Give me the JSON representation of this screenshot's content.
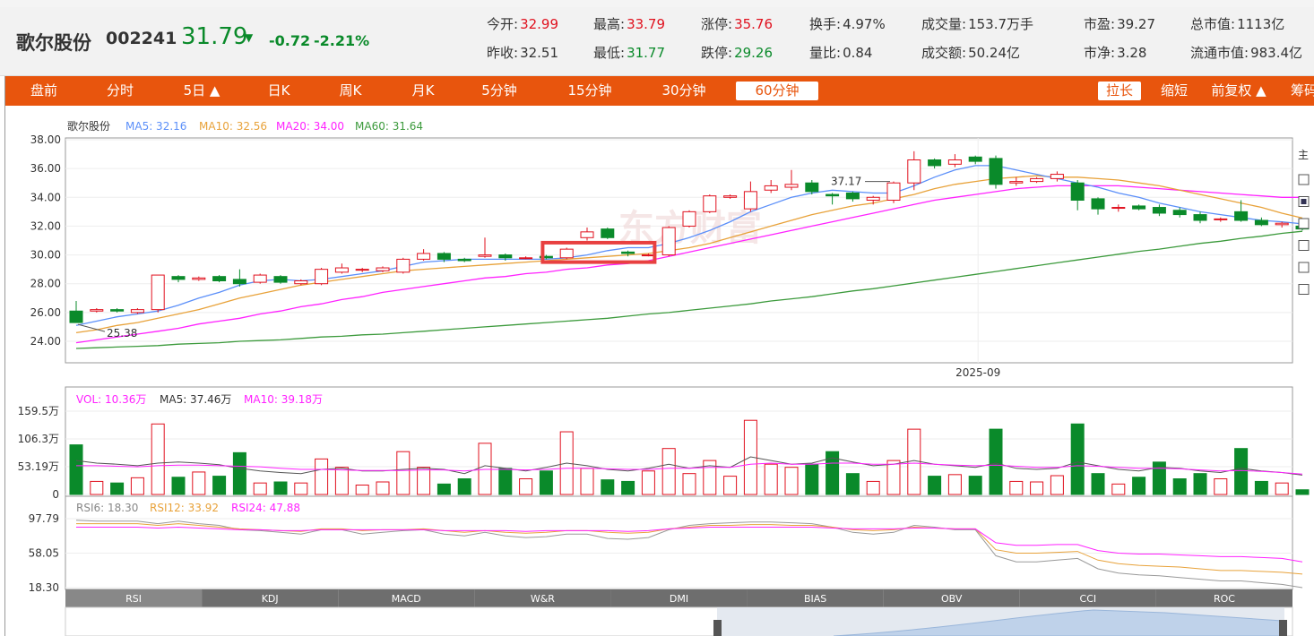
{
  "header": {
    "name": "歌尔股份",
    "code": "002241",
    "price": "31.79",
    "arrow": "▼",
    "change": "-0.72",
    "change_pct": "-2.21%",
    "quotes": [
      {
        "label": "今开:",
        "value": "32.99",
        "color": "red"
      },
      {
        "label": "最高:",
        "value": "33.79",
        "color": "red"
      },
      {
        "label": "涨停:",
        "value": "35.76",
        "color": "red"
      },
      {
        "label": "换手:",
        "value": "4.97%",
        "color": "dark"
      },
      {
        "label": "成交量:",
        "value": "153.7万手",
        "color": "dark"
      },
      {
        "label": "市盈:",
        "value": "39.27",
        "color": "dark"
      },
      {
        "label": "总市值:",
        "value": "1113亿",
        "color": "dark"
      },
      {
        "label": "昨收:",
        "value": "32.51",
        "color": "dark"
      },
      {
        "label": "最低:",
        "value": "31.77",
        "color": "green"
      },
      {
        "label": "跌停:",
        "value": "29.26",
        "color": "green"
      },
      {
        "label": "量比:",
        "value": "0.84",
        "color": "dark"
      },
      {
        "label": "成交额:",
        "value": "50.24亿",
        "color": "dark"
      },
      {
        "label": "市净:",
        "value": "3.28",
        "color": "dark"
      },
      {
        "label": "流通市值:",
        "value": "983.4亿",
        "color": "dark"
      }
    ]
  },
  "tabs": [
    "盘前",
    "分时",
    "5日 ▲",
    "日K",
    "周K",
    "月K",
    "5分钟",
    "15分钟",
    "30分钟",
    "60分钟"
  ],
  "active_tab": 9,
  "right_tabs": [
    "拉长",
    "缩短",
    "前复权 ▲",
    "筹码"
  ],
  "active_right_tab": 0,
  "watermark": "东方财富",
  "indicator_tabs": [
    "RSI",
    "KDJ",
    "MACD",
    "W&R",
    "DMI",
    "BIAS",
    "OBV",
    "CCI",
    "ROC"
  ],
  "active_indicator": 0,
  "side_label": "主",
  "colors": {
    "up": "#e0111e",
    "down": "#0a8a2a",
    "accent": "#e8550d",
    "ma5": "#5b8ff9",
    "ma10": "#e8a23a",
    "ma20": "#ff22ff",
    "ma60": "#3c9a3c"
  },
  "chart_data": {
    "type": "candlestick",
    "name": "歌尔股份",
    "interval": "60分钟",
    "x_label_tick": "2025-09",
    "ylim": [
      24,
      38
    ],
    "yticks": [
      "38.00",
      "36.00",
      "34.00",
      "32.00",
      "30.00",
      "28.00",
      "26.00",
      "24.00"
    ],
    "grid": true,
    "legend": [
      {
        "name": "MA5",
        "value": "32.16"
      },
      {
        "name": "MA10",
        "value": "32.56"
      },
      {
        "name": "MA20",
        "value": "34.00"
      },
      {
        "name": "MA60",
        "value": "31.64"
      }
    ],
    "annotations": [
      {
        "text": "37.17",
        "candle": 40
      },
      {
        "text": "25.38",
        "candle": 0
      }
    ],
    "candles": [
      [
        26.1,
        25.3,
        26.8,
        25.3
      ],
      [
        26.1,
        26.2,
        26.3,
        26.0
      ],
      [
        26.2,
        26.1,
        26.3,
        26.0
      ],
      [
        26.0,
        26.2,
        26.3,
        25.9
      ],
      [
        26.2,
        28.6,
        28.6,
        26.0
      ],
      [
        28.5,
        28.3,
        28.6,
        28.1
      ],
      [
        28.3,
        28.4,
        28.5,
        28.2
      ],
      [
        28.5,
        28.2,
        28.6,
        28.1
      ],
      [
        28.3,
        28.0,
        29.0,
        27.8
      ],
      [
        28.1,
        28.6,
        28.7,
        28.0
      ],
      [
        28.5,
        28.1,
        28.6,
        28.0
      ],
      [
        28.0,
        28.2,
        28.3,
        27.9
      ],
      [
        28.0,
        29.0,
        29.1,
        27.9
      ],
      [
        28.8,
        29.1,
        29.4,
        28.7
      ],
      [
        29.0,
        29.0,
        29.1,
        28.8
      ],
      [
        28.9,
        29.1,
        29.2,
        28.8
      ],
      [
        28.8,
        29.7,
        29.8,
        28.7
      ],
      [
        29.7,
        30.1,
        30.4,
        29.6
      ],
      [
        30.1,
        29.7,
        30.2,
        29.5
      ],
      [
        29.7,
        29.6,
        29.8,
        29.5
      ],
      [
        29.9,
        30.0,
        31.2,
        29.8
      ],
      [
        30.0,
        29.8,
        30.1,
        29.6
      ],
      [
        29.8,
        29.8,
        29.9,
        29.7
      ],
      [
        29.9,
        29.8,
        30.0,
        29.7
      ],
      [
        29.8,
        30.4,
        30.5,
        29.7
      ],
      [
        31.2,
        31.6,
        31.9,
        31.0
      ],
      [
        31.8,
        31.2,
        31.9,
        31.1
      ],
      [
        30.2,
        30.1,
        30.3,
        29.9
      ],
      [
        30.0,
        30.0,
        30.1,
        29.9
      ],
      [
        30.0,
        31.9,
        32.0,
        29.9
      ],
      [
        32.0,
        33.0,
        33.1,
        31.9
      ],
      [
        33.0,
        34.1,
        34.2,
        32.9
      ],
      [
        34.0,
        34.1,
        34.2,
        33.9
      ],
      [
        33.2,
        34.4,
        35.1,
        33.0
      ],
      [
        34.5,
        34.8,
        35.2,
        34.3
      ],
      [
        34.7,
        34.9,
        35.9,
        34.5
      ],
      [
        35.0,
        34.4,
        35.2,
        34.2
      ],
      [
        34.2,
        34.1,
        34.3,
        33.5
      ],
      [
        34.3,
        33.9,
        34.4,
        33.7
      ],
      [
        33.8,
        34.0,
        34.1,
        33.5
      ],
      [
        33.8,
        35.0,
        35.1,
        33.6
      ],
      [
        35.0,
        36.6,
        37.2,
        34.5
      ],
      [
        36.6,
        36.2,
        36.7,
        36.0
      ],
      [
        36.3,
        36.6,
        37.0,
        36.1
      ],
      [
        36.8,
        36.5,
        36.9,
        36.3
      ],
      [
        36.7,
        34.9,
        36.9,
        34.6
      ],
      [
        35.0,
        35.1,
        35.4,
        34.8
      ],
      [
        35.1,
        35.3,
        35.4,
        35.0
      ],
      [
        35.3,
        35.6,
        35.8,
        35.1
      ],
      [
        35.0,
        33.8,
        35.2,
        33.1
      ],
      [
        33.9,
        33.2,
        34.0,
        32.8
      ],
      [
        33.3,
        33.3,
        33.5,
        33.0
      ],
      [
        33.4,
        33.2,
        33.5,
        33.1
      ],
      [
        33.3,
        32.9,
        33.5,
        32.7
      ],
      [
        33.1,
        32.8,
        33.3,
        32.6
      ],
      [
        32.8,
        32.4,
        33.0,
        32.2
      ],
      [
        32.5,
        32.5,
        32.6,
        32.3
      ],
      [
        33.0,
        32.4,
        33.8,
        32.3
      ],
      [
        32.4,
        32.1,
        32.6,
        32.0
      ],
      [
        32.1,
        32.2,
        32.3,
        31.9
      ],
      [
        32.0,
        31.8,
        32.1,
        31.7
      ]
    ],
    "ma5": [
      25.1,
      25.4,
      25.7,
      25.9,
      26.1,
      26.5,
      27.0,
      27.4,
      27.9,
      28.2,
      28.3,
      28.2,
      28.3,
      28.5,
      28.7,
      28.9,
      29.2,
      29.5,
      29.6,
      29.7,
      29.7,
      29.7,
      29.7,
      29.7,
      29.8,
      30.0,
      30.3,
      30.5,
      30.5,
      30.8,
      31.2,
      31.7,
      32.3,
      33.0,
      33.5,
      34.0,
      34.3,
      34.5,
      34.4,
      34.3,
      34.3,
      34.8,
      35.4,
      35.9,
      36.2,
      36.2,
      35.9,
      35.6,
      35.3,
      35.0,
      34.7,
      34.3,
      34.0,
      33.6,
      33.3,
      33.0,
      32.8,
      32.6,
      32.4,
      32.3,
      32.16
    ],
    "ma10": [
      24.6,
      24.8,
      25.1,
      25.3,
      25.6,
      25.9,
      26.2,
      26.6,
      27.0,
      27.3,
      27.6,
      27.9,
      28.1,
      28.3,
      28.5,
      28.7,
      28.9,
      29.0,
      29.1,
      29.2,
      29.3,
      29.4,
      29.5,
      29.6,
      29.7,
      29.8,
      29.9,
      30.0,
      30.1,
      30.3,
      30.5,
      30.8,
      31.2,
      31.6,
      32.0,
      32.4,
      32.8,
      33.1,
      33.4,
      33.6,
      33.9,
      34.2,
      34.6,
      34.9,
      35.1,
      35.3,
      35.4,
      35.5,
      35.4,
      35.4,
      35.3,
      35.2,
      35.0,
      34.8,
      34.5,
      34.2,
      33.9,
      33.6,
      33.3,
      32.9,
      32.56
    ],
    "ma20": [
      23.9,
      24.1,
      24.3,
      24.5,
      24.7,
      24.9,
      25.2,
      25.4,
      25.6,
      25.9,
      26.1,
      26.4,
      26.6,
      26.9,
      27.1,
      27.4,
      27.6,
      27.8,
      28.0,
      28.2,
      28.4,
      28.5,
      28.7,
      28.8,
      29.0,
      29.1,
      29.3,
      29.4,
      29.6,
      29.9,
      30.2,
      30.5,
      30.8,
      31.1,
      31.4,
      31.7,
      32.0,
      32.3,
      32.6,
      32.9,
      33.2,
      33.5,
      33.8,
      34.0,
      34.2,
      34.4,
      34.6,
      34.7,
      34.8,
      34.8,
      34.8,
      34.8,
      34.7,
      34.6,
      34.5,
      34.4,
      34.3,
      34.2,
      34.1,
      34.0,
      34.0
    ],
    "ma60": [
      23.5,
      23.55,
      23.6,
      23.65,
      23.7,
      23.8,
      23.85,
      23.9,
      24.0,
      24.05,
      24.1,
      24.2,
      24.3,
      24.35,
      24.45,
      24.5,
      24.6,
      24.7,
      24.8,
      24.9,
      25.0,
      25.1,
      25.2,
      25.3,
      25.4,
      25.5,
      25.6,
      25.75,
      25.9,
      26.0,
      26.15,
      26.3,
      26.45,
      26.6,
      26.8,
      26.95,
      27.1,
      27.3,
      27.5,
      27.65,
      27.85,
      28.05,
      28.25,
      28.45,
      28.65,
      28.85,
      29.05,
      29.25,
      29.45,
      29.65,
      29.85,
      30.05,
      30.25,
      30.4,
      30.6,
      30.8,
      30.95,
      31.15,
      31.3,
      31.5,
      31.64
    ],
    "volume": {
      "label": "VOL",
      "value": "10.36万",
      "ma5": "37.46万",
      "ma10": "39.18万",
      "ylim": [
        0,
        159.5
      ],
      "yticks": [
        "159.5万",
        "106.3万",
        "53.19万",
        "0"
      ],
      "values": [
        95,
        25,
        22,
        32,
        135,
        33,
        43,
        35,
        80,
        22,
        24,
        22,
        68,
        52,
        18,
        24,
        82,
        52,
        20,
        30,
        98,
        50,
        30,
        45,
        120,
        50,
        28,
        25,
        45,
        88,
        40,
        65,
        35,
        142,
        58,
        52,
        58,
        82,
        40,
        25,
        65,
        125,
        35,
        38,
        35,
        125,
        25,
        24,
        36,
        135,
        40,
        20,
        33,
        62,
        30,
        40,
        30,
        88,
        25,
        22,
        9
      ],
      "ma5_values": [
        65,
        60,
        58,
        55,
        60,
        62,
        60,
        57,
        50,
        45,
        42,
        40,
        48,
        50,
        45,
        45,
        48,
        50,
        48,
        40,
        55,
        50,
        45,
        52,
        60,
        55,
        48,
        45,
        50,
        58,
        50,
        55,
        52,
        72,
        65,
        58,
        60,
        70,
        62,
        55,
        58,
        65,
        58,
        55,
        52,
        60,
        50,
        48,
        50,
        62,
        55,
        48,
        45,
        52,
        50,
        45,
        42,
        50,
        45,
        42,
        37
      ],
      "ma10_values": [
        55,
        55,
        54,
        53,
        55,
        56,
        56,
        55,
        54,
        53,
        50,
        48,
        48,
        47,
        46,
        46,
        46,
        47,
        47,
        45,
        48,
        48,
        47,
        48,
        50,
        50,
        49,
        48,
        48,
        50,
        50,
        52,
        52,
        58,
        60,
        58,
        58,
        60,
        60,
        58,
        58,
        60,
        58,
        56,
        55,
        56,
        54,
        52,
        52,
        55,
        54,
        52,
        50,
        50,
        49,
        47,
        45,
        46,
        44,
        42,
        39
      ]
    },
    "rsi": {
      "label": "RSI",
      "rsi6": "18.30",
      "rsi12": "33.92",
      "rsi24": "47.88",
      "ylim": [
        18.3,
        97.79
      ],
      "yticks": [
        "97.79",
        "58.05",
        "18.30"
      ],
      "rsi6_values": [
        96,
        95,
        95,
        95,
        92,
        95,
        92,
        90,
        85,
        84,
        82,
        80,
        85,
        85,
        80,
        82,
        84,
        85,
        80,
        78,
        82,
        78,
        76,
        77,
        80,
        80,
        75,
        74,
        76,
        85,
        90,
        92,
        93,
        94,
        94,
        93,
        92,
        88,
        82,
        80,
        82,
        90,
        88,
        85,
        85,
        55,
        48,
        48,
        50,
        52,
        40,
        35,
        33,
        32,
        30,
        28,
        26,
        26,
        24,
        22,
        18.3
      ],
      "rsi12_values": [
        92,
        92,
        92,
        92,
        90,
        92,
        90,
        88,
        86,
        85,
        84,
        83,
        86,
        86,
        84,
        85,
        85,
        86,
        84,
        82,
        84,
        82,
        81,
        82,
        84,
        84,
        82,
        81,
        82,
        86,
        88,
        90,
        90,
        91,
        91,
        90,
        90,
        88,
        85,
        84,
        85,
        88,
        87,
        86,
        86,
        62,
        58,
        58,
        59,
        60,
        50,
        46,
        44,
        43,
        42,
        40,
        38,
        38,
        37,
        36,
        33.9
      ],
      "rsi24_values": [
        88,
        88,
        88,
        88,
        87,
        88,
        87,
        86,
        85,
        85,
        84,
        84,
        85,
        85,
        85,
        85,
        85,
        85,
        84,
        84,
        84,
        84,
        83,
        84,
        84,
        84,
        84,
        83,
        84,
        86,
        87,
        88,
        88,
        88,
        88,
        88,
        88,
        87,
        86,
        86,
        86,
        87,
        87,
        86,
        86,
        70,
        67,
        67,
        68,
        68,
        61,
        58,
        57,
        57,
        56,
        55,
        54,
        54,
        53,
        52,
        47.9
      ]
    }
  }
}
